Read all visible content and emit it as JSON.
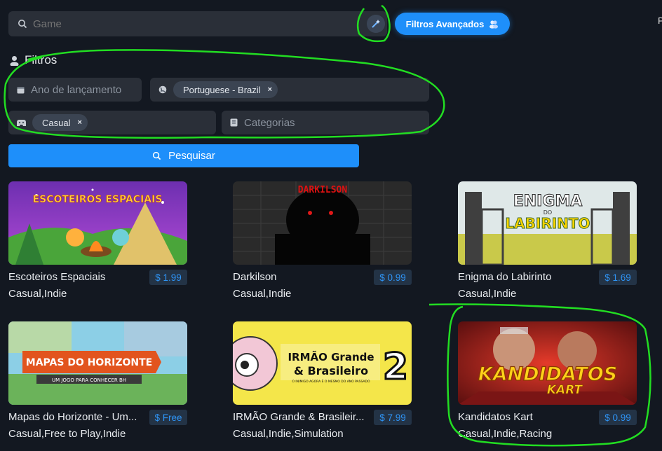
{
  "search": {
    "placeholder": "Game"
  },
  "advanced_filters_label": "Filtros Avançados",
  "top_right_text": "P",
  "filters": {
    "heading": "Filtros",
    "release_year_placeholder": "Ano de lançamento",
    "language_chip": "Portuguese - Brazil",
    "genre_chip": "Casual",
    "categories_placeholder": "Categorias",
    "remove_symbol": "×"
  },
  "search_button_label": "Pesquisar",
  "games": [
    {
      "title": "Escoteiros Espaciais",
      "price": "$ 1.99",
      "tags": "Casual,Indie",
      "art_text": "ESCOTEIROS ESPACIAIS"
    },
    {
      "title": "Darkilson",
      "price": "$ 0.99",
      "tags": "Casual,Indie",
      "art_text": "DARKILSON"
    },
    {
      "title": "Enigma do Labirinto",
      "price": "$ 1.69",
      "tags": "Casual,Indie",
      "art_text": "ENIGMA",
      "art_text2": "DO",
      "art_text3": "LABIRINTO"
    },
    {
      "title": "Mapas do Horizonte - Um...",
      "price": "$ Free",
      "tags": "Casual,Free to Play,Indie",
      "art_text": "MAPAS DO HORIZONTE",
      "art_text2": "UM JOGO PARA CONHECER BH"
    },
    {
      "title": "IRMÃO Grande & Brasileir...",
      "price": "$ 7.99",
      "tags": "Casual,Indie,Simulation",
      "art_text": "IRMÃO Grande",
      "art_text2": "& Brasileiro",
      "art_text3": "2",
      "art_text4": "O INIMIGO AGORA É O MESMO DO ANO PASSADO"
    },
    {
      "title": "Kandidatos Kart",
      "price": "$ 0.99",
      "tags": "Casual,Indie,Racing",
      "art_text": "KANDIDATOS",
      "art_text2": "KART"
    }
  ],
  "colors": {
    "accent": "#1e8ffa",
    "annotation": "#22dd22",
    "background": "#131821"
  },
  "icons": [
    "search-icon",
    "magic-wand-icon",
    "users-icon",
    "user-icon",
    "calendar-icon",
    "globe-icon",
    "gamepad-icon",
    "category-icon"
  ]
}
